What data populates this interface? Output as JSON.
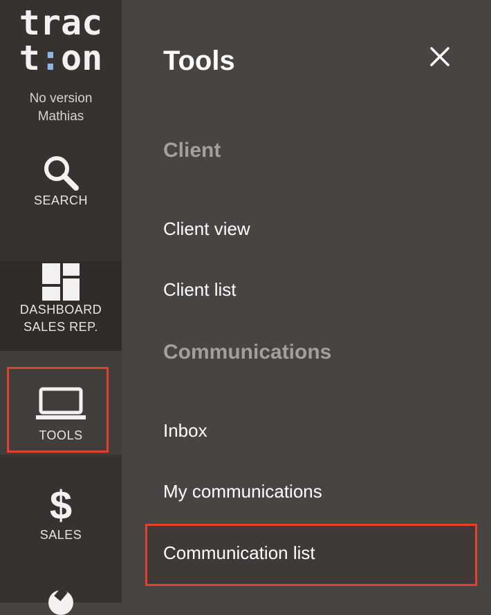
{
  "sidebar": {
    "logo": {
      "line1": "trac",
      "line2_pre": "t",
      "line2_mark": ":",
      "line2_post": "on"
    },
    "version_text": "No version",
    "user_name": "Mathias",
    "items": [
      {
        "label_lines": [
          "SEARCH"
        ],
        "icon": "search-icon"
      },
      {
        "label_lines": [
          "DASHBOARD",
          "SALES REP."
        ],
        "icon": "dashboard-icon"
      },
      {
        "label_lines": [
          "TOOLS"
        ],
        "icon": "laptop-icon",
        "active": true
      },
      {
        "label_lines": [
          "$",
          "SALES"
        ],
        "icon": "dollar-icon"
      },
      {
        "label_lines": [],
        "icon": "wrench-icon"
      }
    ]
  },
  "panel": {
    "title": "Tools",
    "close_icon": "close-icon",
    "sections": [
      {
        "title": "Client",
        "items": [
          "Client view",
          "Client list"
        ]
      },
      {
        "title": "Communications",
        "items": [
          "Inbox",
          "My communications",
          "Communication list"
        ]
      }
    ],
    "highlighted_item": "Communication list"
  },
  "colors": {
    "sidebar_bg": "#353230",
    "panel_bg": "#484441",
    "section_title": "#a59f99",
    "highlight_border": "#e4402b",
    "logo_accent": "#8ab7df"
  }
}
